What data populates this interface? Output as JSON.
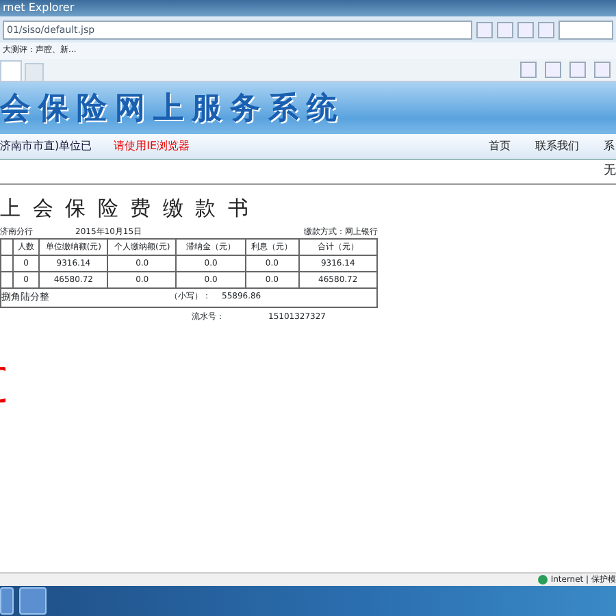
{
  "window": {
    "title": "rnet Explorer"
  },
  "address_bar": {
    "value": "01/siso/default.jsp"
  },
  "favorites_bar": {
    "item": "大测评：声腔、新..."
  },
  "banner": {
    "title": "会保险网上服务系统"
  },
  "nav": {
    "unit": "济南市市直)单位已",
    "notice": "请使用IE浏览器",
    "links": [
      "首页",
      "联系我们",
      "系"
    ]
  },
  "sub_bar": {
    "text": "无"
  },
  "document": {
    "title": "上 会 保 险 费 缴 款 书",
    "bank": "济南分行",
    "date": "2015年10月15日",
    "payment_method": "缴款方式：网上银行",
    "table": {
      "columns": [
        "",
        "人数",
        "单位缴纳额(元)",
        "个人缴纳额(元)",
        "滞纳金（元）",
        "利息（元）",
        "合计（元）"
      ],
      "rows": [
        [
          "",
          "0",
          "9316.14",
          "0.0",
          "0.0",
          "0.0",
          "9316.14"
        ],
        [
          "",
          "0",
          "46580.72",
          "0.0",
          "0.0",
          "0.0",
          "46580.72"
        ]
      ],
      "total_words": "捌角陆分整",
      "total_label": "（小写）：",
      "total_value": "55896.86"
    },
    "serial_label": "流水号：",
    "serial_value": "15101327327"
  },
  "status_bar": {
    "zone": "Internet | 保护模"
  }
}
